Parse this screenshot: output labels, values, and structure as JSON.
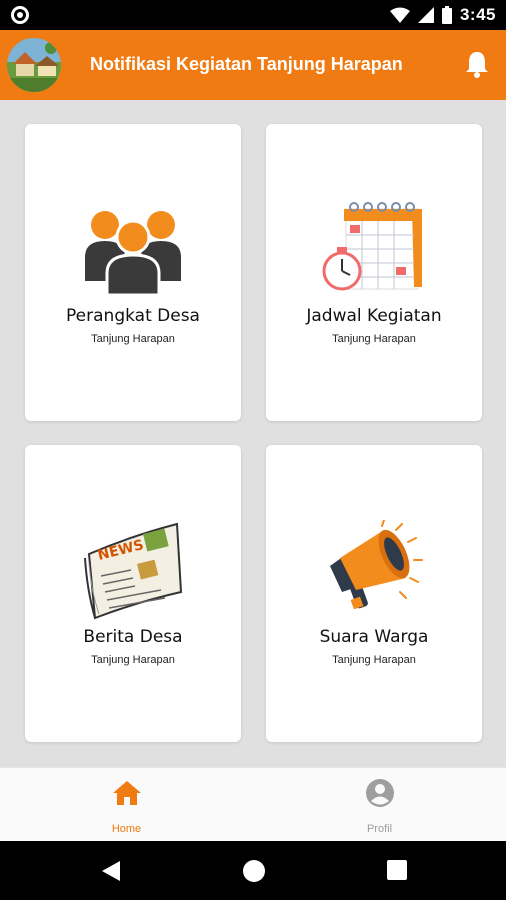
{
  "status_bar": {
    "time": "3:45"
  },
  "app_bar": {
    "title": "Notifikasi Kegiatan Tanjung Harapan"
  },
  "cards": [
    {
      "title": "Perangkat Desa",
      "subtitle": "Tanjung Harapan",
      "icon": "people-icon"
    },
    {
      "title": "Jadwal Kegiatan",
      "subtitle": "Tanjung Harapan",
      "icon": "calendar-icon"
    },
    {
      "title": "Berita Desa",
      "subtitle": "Tanjung Harapan",
      "icon": "newspaper-icon"
    },
    {
      "title": "Suara Warga",
      "subtitle": "Tanjung Harapan",
      "icon": "megaphone-icon"
    }
  ],
  "bottom_nav": {
    "items": [
      {
        "label": "Home",
        "icon": "home-icon",
        "active": true
      },
      {
        "label": "Profil",
        "icon": "profile-icon",
        "active": false
      }
    ]
  },
  "colors": {
    "accent": "#f07b12",
    "active_nav": "#f07b12",
    "inactive_nav": "#9e9e9e"
  }
}
